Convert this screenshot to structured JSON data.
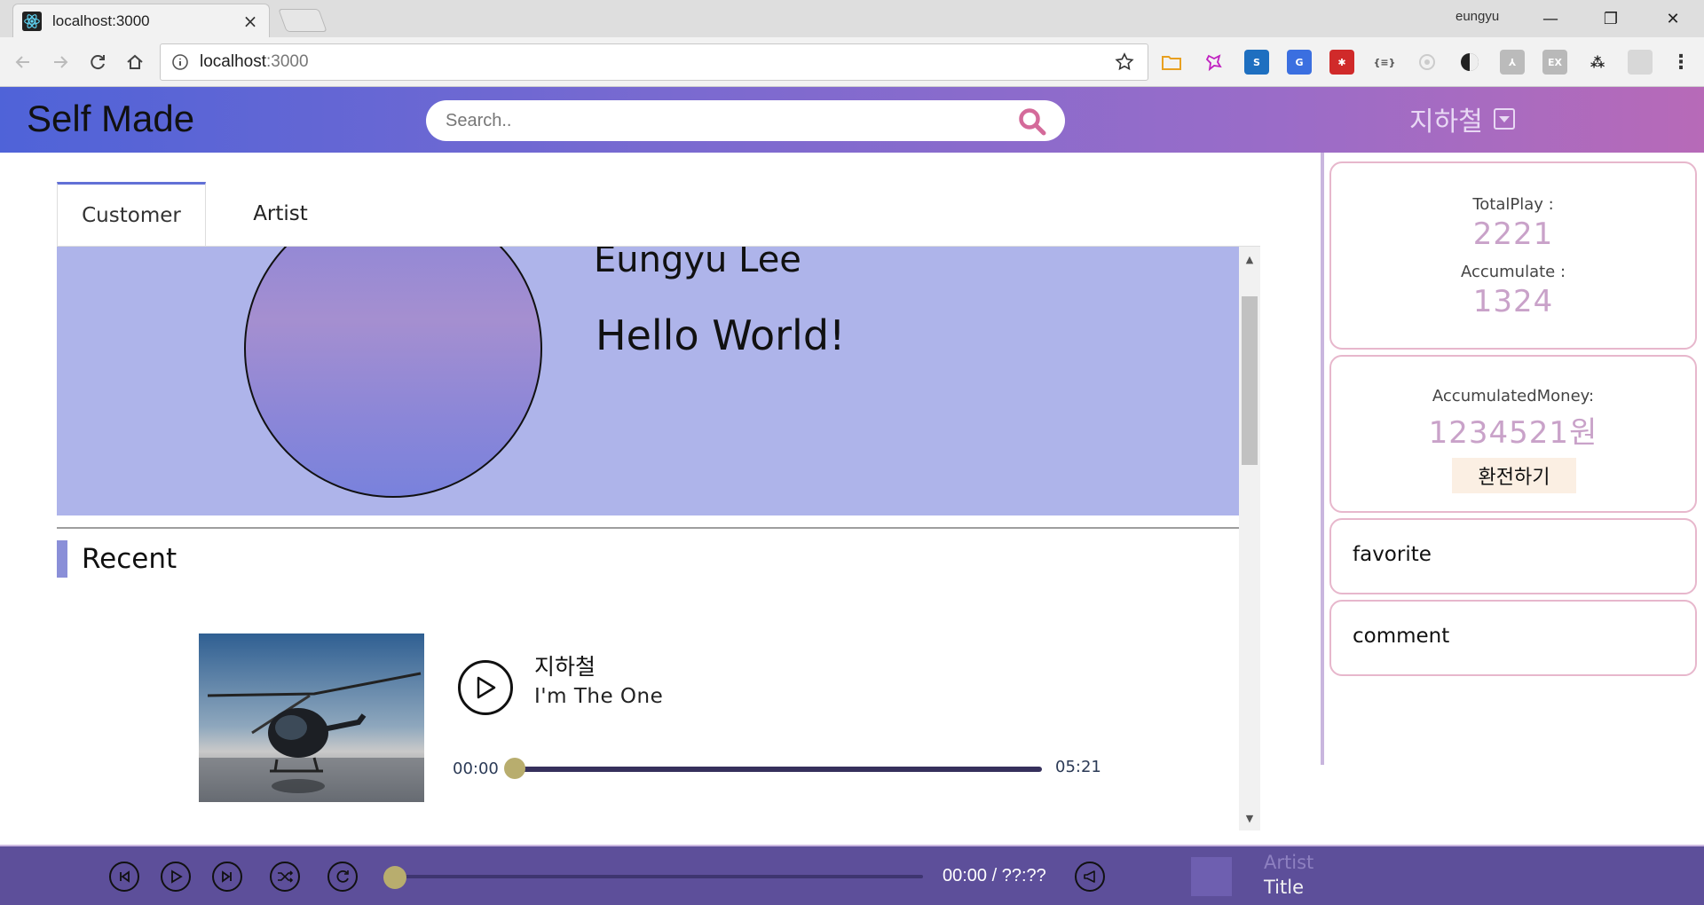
{
  "browser": {
    "tab_title": "localhost:3000",
    "tab_close": "×",
    "profile_name": "eungyu",
    "url_host": "localhost",
    "url_port": ":3000",
    "win_minimize": "—",
    "win_restore": "❐",
    "win_close": "✕"
  },
  "header": {
    "brand": "Self Made",
    "search_placeholder": "Search..",
    "user_name": "지하철"
  },
  "tabs": {
    "customer": "Customer",
    "artist": "Artist"
  },
  "profile": {
    "name": "Eungyu Lee",
    "message": "Hello World!"
  },
  "recent": {
    "title": "Recent",
    "item": {
      "artist": "지하철",
      "title": "I'm The One",
      "time_current": "00:00",
      "time_total": "05:21",
      "progress": 0
    }
  },
  "sidebar": {
    "total_play_label": "TotalPlay :",
    "total_play_value": "2221",
    "accumulate_label": "Accumulate :",
    "accumulate_value": "1324",
    "money_label": "AccumulatedMoney:",
    "money_value": "1234521원",
    "exchange_button": "환전하기",
    "favorite": "favorite",
    "comment": "comment"
  },
  "player": {
    "time": "00:00 / ??:??",
    "artist": "Artist",
    "title": "Title",
    "progress": 0
  },
  "colors": {
    "header_start": "#4f63d8",
    "header_end": "#b76ab8",
    "profile_bg": "#aeb4ea",
    "player_bg": "#5d4f9a",
    "knob": "#b8ad6e",
    "stat_value": "#c9a2c9",
    "search_icon": "#d46a9a"
  }
}
